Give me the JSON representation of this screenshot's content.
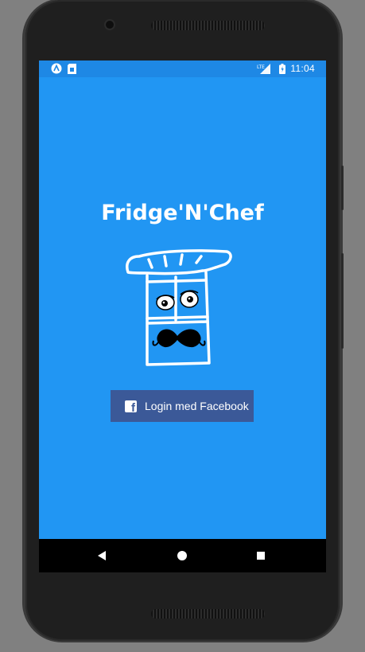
{
  "status_bar": {
    "time": "11:04",
    "network": "LTE",
    "left_icons": [
      "app-notification-icon",
      "sim-icon"
    ],
    "right_icons": [
      "signal-icon",
      "battery-icon"
    ]
  },
  "app": {
    "title": "Fridge'N'Chef",
    "logo": "fridge-chef-mascot-icon"
  },
  "login": {
    "facebook_label": "Login med Facebook",
    "button_color": "#3B5998"
  },
  "nav": {
    "back": "back-icon",
    "home": "home-icon",
    "recents": "recents-icon"
  },
  "colors": {
    "screen_bg": "#2196F3",
    "status_bg": "#1E88E5",
    "nav_bg": "#000000"
  }
}
